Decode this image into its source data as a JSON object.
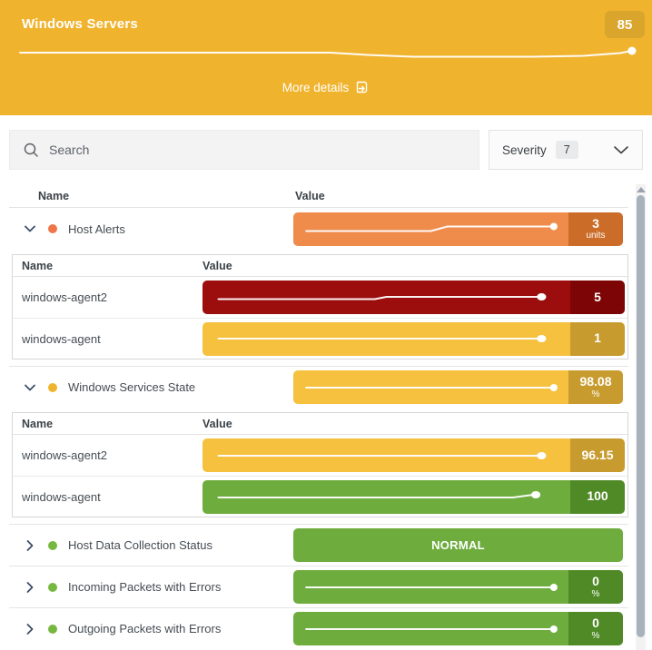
{
  "header": {
    "title": "Windows Servers",
    "badge": "85",
    "more_details_label": "More details",
    "bg_color": "#F0B32E",
    "badge_color": "#DAA52D"
  },
  "toolbar": {
    "search_placeholder": "Search",
    "severity_label": "Severity",
    "severity_count": "7"
  },
  "table": {
    "columns": {
      "name": "Name",
      "value": "Value"
    },
    "rows": [
      {
        "label": "Host Alerts",
        "expanded": true,
        "dot_color": "#F0764A",
        "bar_color": "#EF8C4C",
        "box_color": "#CB6C28",
        "value": "3",
        "unit": "units",
        "children_columns": {
          "name": "Name",
          "value": "Value"
        },
        "children": [
          {
            "label": "windows-agent2",
            "bar_color": "#9C0D0D",
            "box_color": "#7D0505",
            "value": "5",
            "unit": ""
          },
          {
            "label": "windows-agent",
            "bar_color": "#F5C13E",
            "box_color": "#C79B2E",
            "value": "1",
            "unit": ""
          }
        ]
      },
      {
        "label": "Windows Services State",
        "expanded": true,
        "dot_color": "#EFB42D",
        "bar_color": "#F5C13E",
        "box_color": "#C79B2E",
        "value": "98.08",
        "unit": "%",
        "children_columns": {
          "name": "Name",
          "value": "Value"
        },
        "children": [
          {
            "label": "windows-agent2",
            "bar_color": "#F5C13E",
            "box_color": "#C79B2E",
            "value": "96.15",
            "unit": ""
          },
          {
            "label": "windows-agent",
            "bar_color": "#6EAC3E",
            "box_color": "#4F8A26",
            "value": "100",
            "unit": ""
          }
        ]
      },
      {
        "label": "Host Data Collection Status",
        "expanded": false,
        "dot_color": "#76B83F",
        "bar_color": "#6EAC3E",
        "status_text": "NORMAL"
      },
      {
        "label": "Incoming Packets with Errors",
        "expanded": false,
        "dot_color": "#76B83F",
        "bar_color": "#6EAC3E",
        "box_color": "#4F8A26",
        "value": "0",
        "unit": "%"
      },
      {
        "label": "Outgoing Packets with Errors",
        "expanded": false,
        "dot_color": "#76B83F",
        "bar_color": "#6EAC3E",
        "box_color": "#4F8A26",
        "value": "0",
        "unit": "%"
      }
    ]
  }
}
